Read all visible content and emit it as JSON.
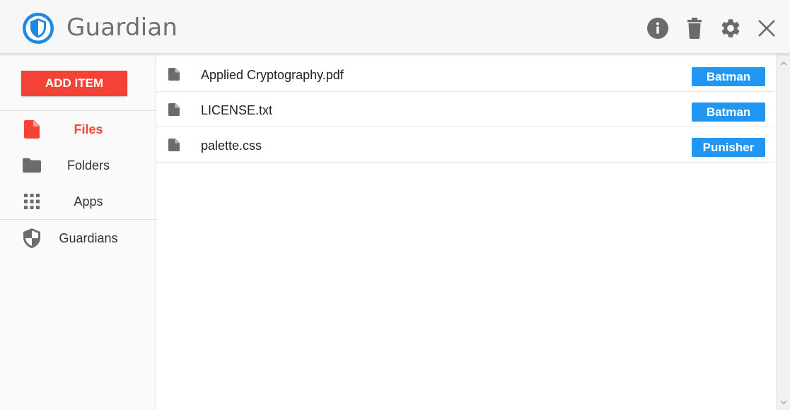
{
  "app": {
    "title": "Guardian",
    "logo_icon": "shield-logo-icon",
    "accent_color": "#f44336",
    "brand_color": "#1e88e5",
    "badge_color": "#2196f3"
  },
  "header": {
    "actions": [
      {
        "name": "info-icon",
        "label": "Info"
      },
      {
        "name": "trash-icon",
        "label": "Delete"
      },
      {
        "name": "gear-icon",
        "label": "Settings"
      },
      {
        "name": "close-icon",
        "label": "Close"
      }
    ]
  },
  "sidebar": {
    "add_button_label": "ADD ITEM",
    "items": [
      {
        "label": "Files",
        "icon": "file-icon",
        "active": true
      },
      {
        "label": "Folders",
        "icon": "folder-icon",
        "active": false
      },
      {
        "label": "Apps",
        "icon": "apps-grid-icon",
        "active": false
      },
      {
        "label": "Guardians",
        "icon": "shield-icon",
        "active": false
      }
    ]
  },
  "files": [
    {
      "name": "Applied Cryptography.pdf",
      "guardian": "Batman"
    },
    {
      "name": "LICENSE.txt",
      "guardian": "Batman"
    },
    {
      "name": "palette.css",
      "guardian": "Punisher"
    }
  ]
}
